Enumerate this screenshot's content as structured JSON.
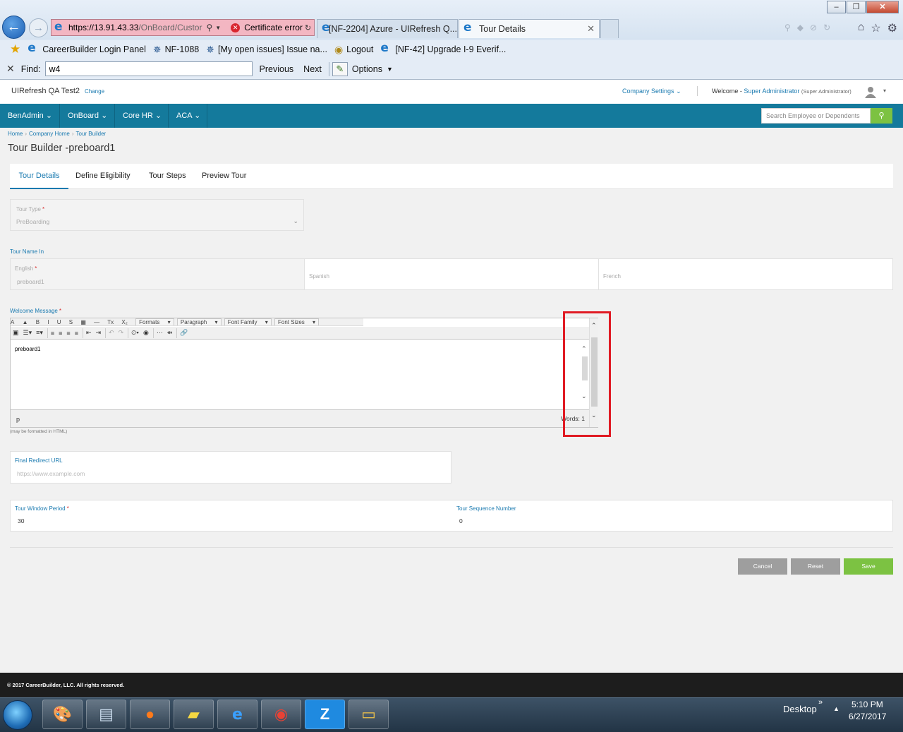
{
  "browser": {
    "url_host": "https://13.91.43.33",
    "url_rest": "/OnBoard/Custor",
    "cert_error": "Certificate error",
    "tabs": [
      {
        "label": "[NF-2204] Azure - UIRefresh Q..."
      },
      {
        "label": "Tour Details"
      }
    ],
    "favorites": [
      {
        "label": "CareerBuilder Login Panel"
      },
      {
        "label": "NF-1088"
      },
      {
        "label": "[My open issues] Issue na..."
      },
      {
        "label": "Logout"
      },
      {
        "label": "[NF-42] Upgrade I-9 Everif..."
      }
    ],
    "find": {
      "label": "Find:",
      "value": "w4",
      "previous": "Previous",
      "next": "Next",
      "options": "Options"
    }
  },
  "header": {
    "company": "UIRefresh QA Test2",
    "change": "Change",
    "company_settings": "Company Settings",
    "welcome": "Welcome -",
    "user": "Super Administrator",
    "role": "(Super Administrator)"
  },
  "nav": {
    "items": [
      {
        "label": "BenAdmin"
      },
      {
        "label": "OnBoard"
      },
      {
        "label": "Core HR"
      },
      {
        "label": "ACA"
      }
    ],
    "search_placeholder": "Search Employee or Dependents"
  },
  "breadcrumb": [
    "Home",
    "Company Home",
    "Tour Builder"
  ],
  "page_title": "Tour Builder -preboard1",
  "tabs": [
    {
      "label": "Tour Details",
      "active": true
    },
    {
      "label": "Define Eligibility"
    },
    {
      "label": "Tour Steps"
    },
    {
      "label": "Preview Tour"
    }
  ],
  "form": {
    "tour_type_label": "Tour Type",
    "tour_type_value": "PreBoarding",
    "tour_name_in": "Tour Name In",
    "english_label": "English",
    "english_value": "preboard1",
    "spanish_label": "Spanish",
    "french_label": "French",
    "welcome_label": "Welcome Message",
    "editor": {
      "toolbar_menus": [
        "Formats",
        "Paragraph",
        "Font Family",
        "Font Sizes"
      ],
      "content": "preboard1",
      "path": "p",
      "words": "Words: 1",
      "hint": "(may be formatted in HTML)"
    },
    "redirect_label": "Final Redirect URL",
    "redirect_placeholder": "https://www.example.com",
    "window_label": "Tour Window Period",
    "window_value": "30",
    "sequence_label": "Tour Sequence Number",
    "sequence_value": "0"
  },
  "buttons": {
    "cancel": "Cancel",
    "reset": "Reset",
    "save": "Save"
  },
  "footer": "© 2017 CareerBuilder, LLC. All rights reserved.",
  "taskbar": {
    "desktop": "Desktop",
    "time": "5:10 PM",
    "date": "6/27/2017"
  },
  "colors": {
    "accent": "#1a7ab0",
    "nav_bg": "#147a9c",
    "save": "#7cc242",
    "highlight": "#e01b24"
  }
}
